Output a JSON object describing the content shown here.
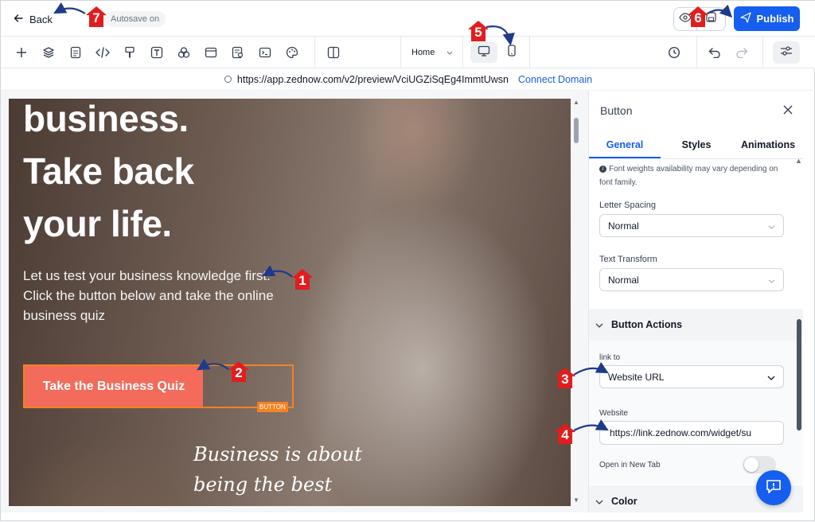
{
  "header": {
    "back_label": "Back",
    "autosave_label": "Autosave on",
    "publish_label": "Publish"
  },
  "toolbar": {
    "tools": [
      "plus-icon",
      "layers-icon",
      "page-icon",
      "code-icon",
      "paint-icon",
      "text-icon",
      "elements-icon",
      "layout-icon",
      "form-icon",
      "terminal-icon",
      "palette-icon",
      "split-view-icon"
    ],
    "page_select": "Home",
    "device_desktop": "desktop-icon",
    "device_mobile": "mobile-icon"
  },
  "urlbar": {
    "url": "https://app.zednow.com/v2/preview/VciUGZiSqEg4ImmtUwsn",
    "connect_label": "Connect Domain"
  },
  "canvas": {
    "hero_lines": [
      "business.",
      "Take back",
      "your life."
    ],
    "hero_text": "Let us test your business knowledge first. Click the button below and take the online business quiz",
    "cta_label": "Take the Business Quiz",
    "selection_tag": "BUTTON",
    "script_line1": "Business is about",
    "script_line2": "being the best"
  },
  "panel": {
    "title": "Button",
    "tabs": [
      "General",
      "Styles",
      "Animations"
    ],
    "note": "Font weights availability may vary depending on font family.",
    "letter_spacing_label": "Letter Spacing",
    "letter_spacing_value": "Normal",
    "text_transform_label": "Text Transform",
    "text_transform_value": "Normal",
    "button_actions_label": "Button Actions",
    "link_to_label": "link to",
    "link_to_value": "Website URL",
    "website_label": "Website",
    "website_value": "https://link.zednow.com/widget/su",
    "new_tab_label": "Open in New Tab",
    "color_label": "Color"
  },
  "annotations": [
    "1",
    "2",
    "3",
    "4",
    "5",
    "6",
    "7"
  ],
  "colors": {
    "accent": "#155eef",
    "cta": "#f26b5b",
    "selection": "#f58220",
    "annotation": "#e11d1d",
    "arrow": "#1e3a8a"
  }
}
